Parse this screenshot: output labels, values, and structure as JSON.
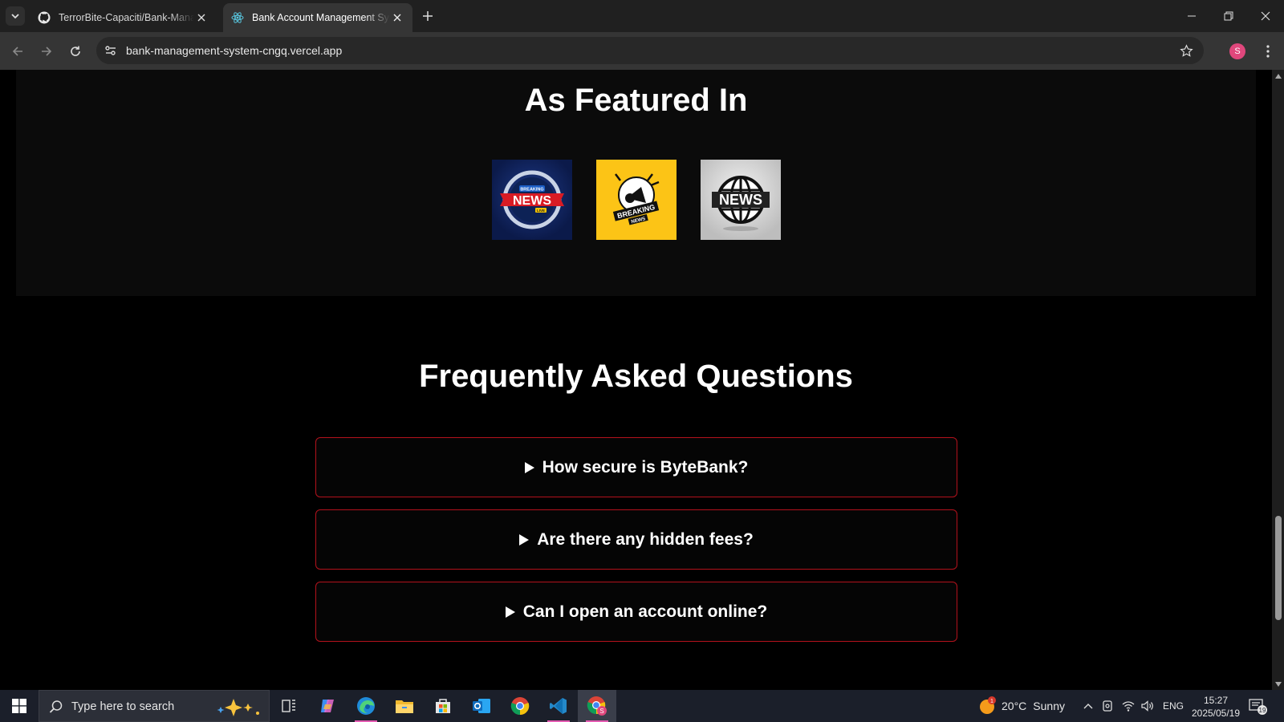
{
  "browser": {
    "tabs": [
      {
        "title": "TerrorBite-Capaciti/Bank-Manag",
        "favicon": "github-icon"
      },
      {
        "title": "Bank Account Management Sys",
        "favicon": "react-icon",
        "active": true
      }
    ],
    "url": "bank-management-system-cngq.vercel.app",
    "profile_initial": "S"
  },
  "page": {
    "featured": {
      "heading": "As Featured In",
      "logos": [
        {
          "name": "breaking-news-live-logo",
          "text": "NEWS",
          "small_top": "BREAKING",
          "small_bottom": "LIVE"
        },
        {
          "name": "breaking-news-megaphone-logo",
          "text": "BREAKING",
          "sub": "NEWS"
        },
        {
          "name": "globe-news-logo",
          "text": "NEWS"
        }
      ]
    },
    "faq": {
      "heading": "Frequently Asked Questions",
      "items": [
        {
          "question": "How secure is ByteBank?"
        },
        {
          "question": "Are there any hidden fees?"
        },
        {
          "question": "Can I open an account online?"
        }
      ]
    }
  },
  "taskbar": {
    "search_placeholder": "Type here to search",
    "apps": [
      "task-view-icon",
      "copilot-icon",
      "edge-icon",
      "file-explorer-icon",
      "microsoft-store-icon",
      "outlook-icon",
      "chrome-icon",
      "vscode-icon",
      "chrome-profile-icon"
    ],
    "weather": {
      "temp": "20°C",
      "condition": "Sunny",
      "badge": "1"
    },
    "language": "ENG",
    "time": "15:27",
    "date": "2025/05/19",
    "notification_count": "19"
  },
  "colors": {
    "faq_border": "#b3121c",
    "featured_bg": "#0b0b0b",
    "logo2_bg": "#fcc416"
  }
}
